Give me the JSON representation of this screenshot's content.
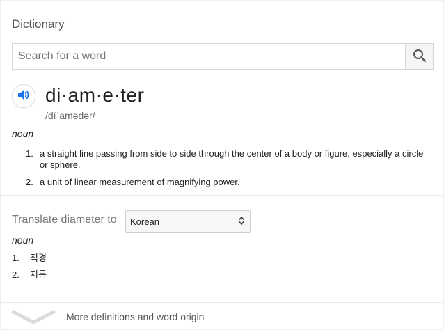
{
  "dictionary": {
    "title": "Dictionary",
    "search": {
      "placeholder": "Search for a word",
      "value": ""
    },
    "icons": {
      "search": "search-icon",
      "audio": "speaker-icon",
      "more": "chevron-down-icon",
      "select": "select-arrows-icon"
    },
    "entry": {
      "word": "di·am·e·ter",
      "phonetic": "/dīˈamədər/",
      "part_of_speech": "noun",
      "definitions": [
        {
          "num": "1.",
          "text": "a straight line passing from side to side through the center of a body or figure, especially a circle or sphere."
        },
        {
          "num": "2.",
          "text": "a unit of linear measurement of magnifying power."
        }
      ]
    },
    "translate": {
      "label": "Translate diameter to",
      "selected_language": "Korean",
      "part_of_speech": "noun",
      "results": [
        {
          "num": "1.",
          "text": "직경"
        },
        {
          "num": "2.",
          "text": "지름"
        }
      ]
    },
    "more_link": "More definitions and word origin",
    "colors": {
      "audio_icon": "#1a73e8",
      "title": "#555555",
      "muted": "#777777"
    }
  }
}
